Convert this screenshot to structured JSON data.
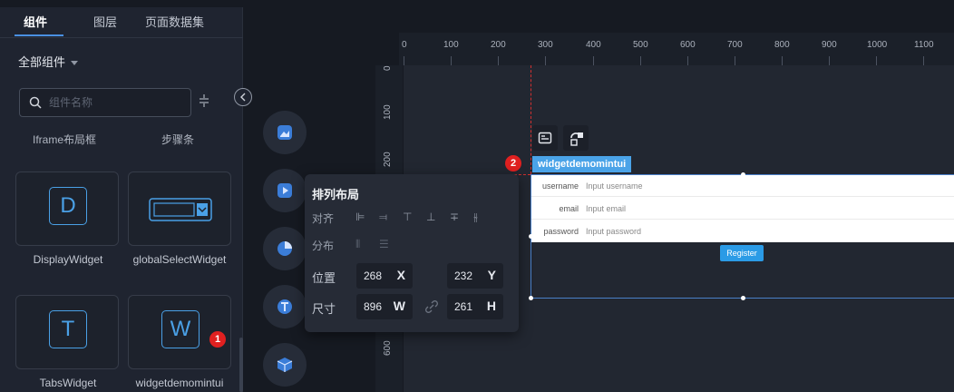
{
  "left_panel": {
    "tabs": [
      "组件",
      "图层",
      "页面数据集"
    ],
    "category_label": "全部组件",
    "search_placeholder": "组件名称",
    "plain_items": [
      "Iframe布局框",
      "步骤条"
    ],
    "cards": [
      {
        "icon_letter": "D",
        "label": "DisplayWidget"
      },
      {
        "icon_letter": "",
        "label": "globalSelectWidget"
      },
      {
        "icon_letter": "T",
        "label": "TabsWidget"
      },
      {
        "icon_letter": "W",
        "label": "widgetdemomintui"
      }
    ],
    "badge": "1"
  },
  "toolbar_icons": [
    "image-widget-icon",
    "video-widget-icon",
    "chart-widget-icon",
    "text-widget-icon",
    "3d-widget-icon"
  ],
  "canvas": {
    "ruler_top": [
      "0",
      "100",
      "200",
      "300",
      "400",
      "500",
      "600",
      "700",
      "800",
      "900",
      "1000",
      "1100"
    ],
    "ruler_left": [
      "0",
      "100",
      "200",
      "600"
    ],
    "widget_tag": "widgetdemomintui",
    "badge": "2",
    "form": {
      "rows": [
        {
          "label": "username",
          "placeholder": "Input username"
        },
        {
          "label": "email",
          "placeholder": "Input email"
        },
        {
          "label": "password",
          "placeholder": "Input password"
        }
      ],
      "button": "Register"
    }
  },
  "arrange_popup": {
    "title": "排列布局",
    "align_label": "对齐",
    "distribute_label": "分布",
    "position_label": "位置",
    "size_label": "尺寸",
    "x_value": "268",
    "x_unit": "X",
    "y_value": "232",
    "y_unit": "Y",
    "w_value": "896",
    "w_unit": "W",
    "h_value": "261",
    "h_unit": "H"
  },
  "colors": {
    "accent": "#4aa3e8",
    "badge": "#e02020",
    "panel": "#1f2430"
  }
}
